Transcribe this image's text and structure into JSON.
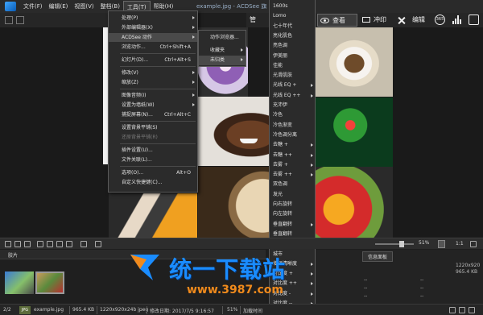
{
  "menubar": {
    "items": [
      "文件(F)",
      "编辑(E)",
      "视图(V)",
      "整档(B)",
      "工具(T)",
      "帮助(H)"
    ],
    "active_index": 4,
    "window_title": "example.jpg - ACDSee 旗"
  },
  "modebar": {
    "view_label": "查看",
    "print_label": "冲印",
    "edit_label": "编辑",
    "overflow_label": "管",
    "round_icon_text": "365"
  },
  "tools_menu": {
    "items": [
      {
        "label": "处理(P)",
        "shortcut": "",
        "submenu": true
      },
      {
        "label": "外部编辑器(X)",
        "shortcut": "",
        "submenu": true
      },
      {
        "label": "ACDSee 动作",
        "shortcut": "",
        "submenu": true,
        "highlight": true
      },
      {
        "label": "浏览动作...",
        "shortcut": "Ctrl+Shift+A",
        "submenu": false
      },
      {
        "label": "幻灯片(D)...",
        "shortcut": "Ctrl+Alt+S",
        "submenu": false
      },
      {
        "label": "修改(V)",
        "shortcut": "",
        "submenu": true
      },
      {
        "label": "缩放(Z)",
        "shortcut": "",
        "submenu": true
      },
      {
        "label": "图像音频(I)",
        "shortcut": "",
        "submenu": true
      },
      {
        "label": "设置为墙纸(W)",
        "shortcut": "",
        "submenu": true
      },
      {
        "label": "捕捉屏幕(N)...",
        "shortcut": "Ctrl+Alt+C",
        "submenu": false
      },
      {
        "label": "设置背景平铺(S)",
        "shortcut": "",
        "submenu": false
      },
      {
        "label": "还原背景平铺(R)",
        "shortcut": "",
        "submenu": false,
        "disabled": true
      },
      {
        "label": "插件设置(U)...",
        "shortcut": "",
        "submenu": false
      },
      {
        "label": "文件关联(L)...",
        "shortcut": "",
        "submenu": false
      },
      {
        "label": "选项(O)...",
        "shortcut": "Alt+O",
        "submenu": false
      },
      {
        "label": "自定义快捷键(C)...",
        "shortcut": "",
        "submenu": false
      }
    ]
  },
  "actions_menu": {
    "items": [
      {
        "label": "动作浏览器...",
        "submenu": false
      },
      {
        "label": "收藏夹",
        "submenu": true
      },
      {
        "label": "未归类",
        "submenu": true,
        "highlight": true
      }
    ]
  },
  "effects_menu": {
    "items": [
      "1600s",
      "Lomo",
      "七十年代",
      "亮化肌色",
      "亮色调",
      "伊美丽",
      "佳能",
      "光滑肌肤",
      "光线 EQ +",
      "光线 EQ ++",
      "充沛伊",
      "冷色",
      "冷色渐变",
      "冷色调分离",
      "去糖 +",
      "去糖 ++",
      "去雾 +",
      "去雾 ++",
      "双色调",
      "发光",
      "向右旋转",
      "向左旋转",
      "垂直翻转",
      "垂直翻转",
      "垃圾",
      "城市",
      "增强清晰度",
      "对比度 +",
      "对比度 ++",
      "对比度 -",
      "对比度 --"
    ],
    "submenu_flags": [
      false,
      false,
      false,
      false,
      false,
      false,
      false,
      false,
      true,
      true,
      false,
      false,
      false,
      false,
      true,
      true,
      true,
      true,
      false,
      false,
      false,
      false,
      true,
      false,
      false,
      false,
      true,
      true,
      true,
      true,
      true
    ]
  },
  "bottom_toolbar": {
    "zoom_text": "51%",
    "zoom_fraction": 0.62,
    "page_text": "1:1"
  },
  "filmstrip": {
    "title": "胶片"
  },
  "info_panel": {
    "tab_label": "信息面板",
    "rows": [
      {
        "label": "",
        "value": "1220x920"
      },
      {
        "label": "",
        "value": "965.4 KB"
      },
      {
        "label": "--",
        "value": "--"
      },
      {
        "label": "--",
        "value": "--"
      },
      {
        "label": "--",
        "value": "--"
      }
    ]
  },
  "statusbar": {
    "count": "2/2",
    "type_badge": "JPG",
    "filename": "example.jpg",
    "filesize": "965.4 KB",
    "dims": "1220x920x24b jpeg",
    "modified": "修改日期: 2017/7/5 9:16:57",
    "zoom": "51%",
    "decode": "加载时间"
  },
  "watermark": {
    "text": "统一下载站",
    "url": "www.3987.com"
  }
}
